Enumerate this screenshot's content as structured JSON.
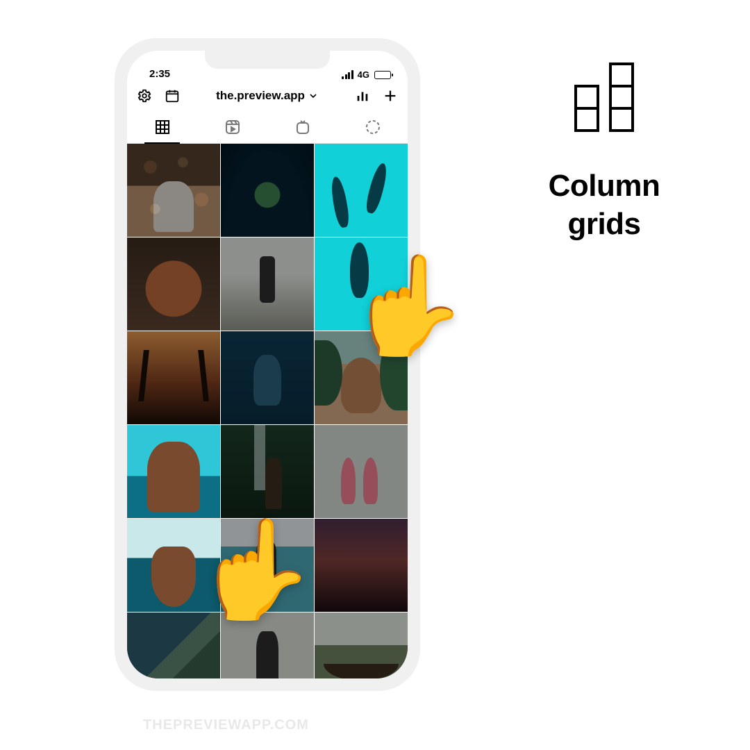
{
  "status": {
    "time": "2:35",
    "network": "4G"
  },
  "header": {
    "title": "the.preview.app",
    "icons": {
      "settings": "gear-icon",
      "calendar": "calendar-icon",
      "analytics": "analytics-icon",
      "add": "plus-icon"
    }
  },
  "tabs": [
    {
      "name": "grid",
      "active": true
    },
    {
      "name": "reels",
      "active": false
    },
    {
      "name": "igtv",
      "active": false
    },
    {
      "name": "stories",
      "active": false
    }
  ],
  "grid_images": [
    {
      "desc": "woman-bikini-bokeh",
      "highlight": false
    },
    {
      "desc": "sea-turtle",
      "highlight": false
    },
    {
      "desc": "whales-aerial-top",
      "highlight": true
    },
    {
      "desc": "poodle-dog",
      "highlight": false
    },
    {
      "desc": "person-walking-road",
      "highlight": false
    },
    {
      "desc": "whales-aerial-bottom",
      "highlight": true
    },
    {
      "desc": "sunset-palms-couple",
      "highlight": false
    },
    {
      "desc": "snorkeler-underwater",
      "highlight": false
    },
    {
      "desc": "woman-selfie-leaves",
      "highlight": false
    },
    {
      "desc": "woman-braids-water",
      "highlight": true
    },
    {
      "desc": "woman-waterfall",
      "highlight": false
    },
    {
      "desc": "flamingos",
      "highlight": false
    },
    {
      "desc": "woman-half-underwater",
      "highlight": true
    },
    {
      "desc": "person-poolside",
      "highlight": false
    },
    {
      "desc": "palm-dusk-reflection",
      "highlight": false
    },
    {
      "desc": "aerial-coastline",
      "highlight": false
    },
    {
      "desc": "woman-yoga-stretch",
      "highlight": false
    },
    {
      "desc": "hammock-garden",
      "highlight": false
    }
  ],
  "side": {
    "title_line1": "Column",
    "title_line2": "grids"
  },
  "watermark": "THEPREVIEWAPP.COM"
}
